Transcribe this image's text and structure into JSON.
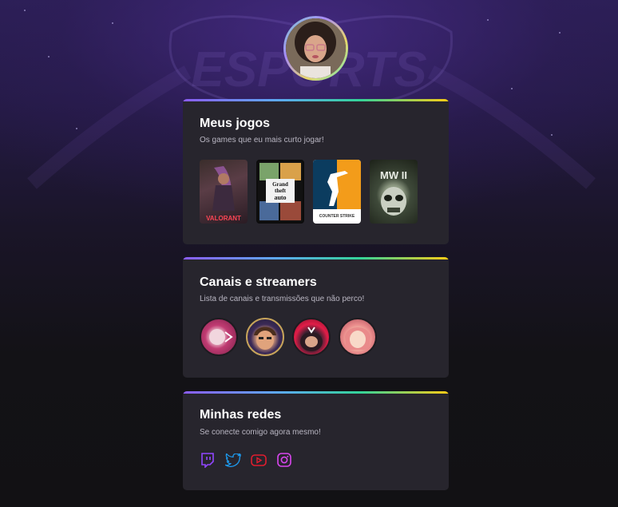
{
  "background": {
    "logo_text": "ESPORTS"
  },
  "profile": {
    "avatar_icon": "user-avatar"
  },
  "games_card": {
    "title": "Meus jogos",
    "subtitle": "Os games que eu mais curto jogar!",
    "games": [
      {
        "name": "VALORANT",
        "icon": "valorant-cover"
      },
      {
        "name": "GTA V",
        "icon": "gta-cover"
      },
      {
        "name": "COUNTER STRIKE",
        "icon": "counter-strike-cover"
      },
      {
        "name": "MW II",
        "icon": "modern-warfare-cover"
      }
    ]
  },
  "streamers_card": {
    "title": "Canais e streamers",
    "subtitle": "Lista de canais e transmissões que não perco!",
    "streamers": [
      {
        "icon": "streamer-avatar-1"
      },
      {
        "icon": "streamer-avatar-2"
      },
      {
        "icon": "streamer-avatar-3"
      },
      {
        "icon": "streamer-avatar-4"
      }
    ]
  },
  "social_card": {
    "title": "Minhas redes",
    "subtitle": "Se conecte comigo agora mesmo!",
    "networks": [
      {
        "name": "twitch",
        "color": "#9146ff"
      },
      {
        "name": "twitter",
        "color": "#1d9bf0"
      },
      {
        "name": "youtube",
        "color": "#e11d2e"
      },
      {
        "name": "instagram",
        "color": "#d946ef"
      }
    ]
  },
  "colors": {
    "card_bg": "#27252d",
    "page_bg": "#121114",
    "accent_gradient": [
      "#8b5cf6",
      "#60a5fa",
      "#34d399",
      "#facc15"
    ]
  }
}
